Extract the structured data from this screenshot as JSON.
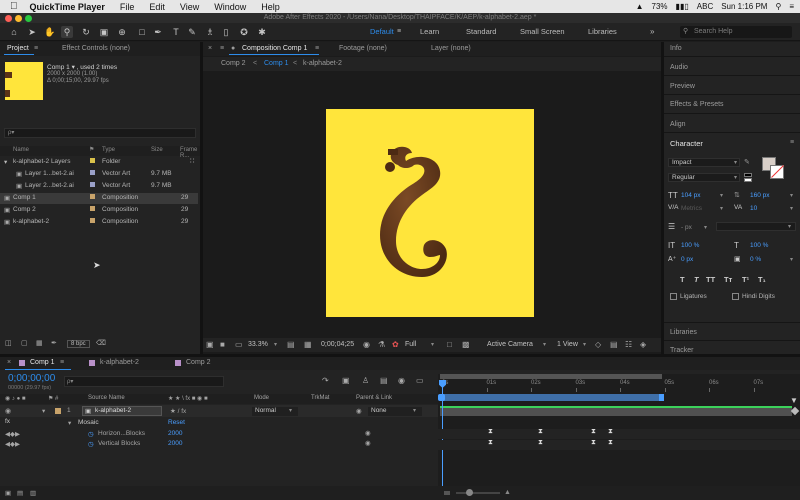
{
  "menubar": {
    "app": "QuickTime Player",
    "items": [
      "File",
      "Edit",
      "View",
      "Window",
      "Help"
    ],
    "battery": "73%",
    "input": "ABC",
    "clock": "Sun 1:16 PM"
  },
  "window_title": "Adobe After Effects 2020 - /Users/Nana/Desktop/THAIPFACE/K/AEP/k-alphabet-2.aep *",
  "workspaces": {
    "items": [
      "Default",
      "Learn",
      "Standard",
      "Small Screen",
      "Libraries"
    ],
    "active": "Default"
  },
  "search_help": {
    "placeholder": "Search Help"
  },
  "project": {
    "tab_project": "Project",
    "tab_effect_controls": "Effect Controls (none)",
    "selected_name": "Comp 1 ▾ , used 2 times",
    "selected_dims": "2000 x 2000 (1.00)",
    "selected_duration": "Δ 0;00;15;00, 29.97 fps",
    "search_placeholder": "ρ▾",
    "columns": {
      "name": "Name",
      "type": "Type",
      "size": "Size",
      "frame_rate": "Frame R..."
    },
    "rows": [
      {
        "name": "k-alphabet-2 Layers",
        "type": "Folder",
        "size": "",
        "fps": "",
        "swatch": "#d9c14a"
      },
      {
        "name": "Layer 1...bet-2.ai",
        "type": "Vector Art",
        "size": "9.7 MB",
        "fps": "",
        "swatch": "#9aa0c8"
      },
      {
        "name": "Layer 2...bet-2.ai",
        "type": "Vector Art",
        "size": "9.7 MB",
        "fps": "",
        "swatch": "#9aa0c8"
      },
      {
        "name": "Comp 1",
        "type": "Composition",
        "size": "",
        "fps": "29",
        "swatch": "#c8a36a"
      },
      {
        "name": "Comp 2",
        "type": "Composition",
        "size": "",
        "fps": "29",
        "swatch": "#c8a36a"
      },
      {
        "name": "k-alphabet-2",
        "type": "Composition",
        "size": "",
        "fps": "29",
        "swatch": "#c8a36a"
      }
    ],
    "bpc": "8 bpc"
  },
  "composition": {
    "tab_comp": "Composition Comp 1",
    "tab_footage": "Footage (none)",
    "tab_layer": "Layer (none)",
    "breadcrumbs": [
      "Comp 2",
      "Comp 1",
      "k-alphabet-2"
    ],
    "zoom": "33.3%",
    "timecode": "0;00;04;25",
    "resolution": "Full",
    "camera": "Active Camera",
    "views": "1 View",
    "frame_color": "#ffe53b",
    "glyph_color": "#5a3317"
  },
  "right_panels": {
    "items": [
      "Info",
      "Audio",
      "Preview",
      "Effects & Presets",
      "Align"
    ],
    "character": "Character",
    "libraries": "Libraries",
    "tracker": "Tracker"
  },
  "character": {
    "font": "Impact",
    "style": "Regular",
    "size": "104 px",
    "leading": "160 px",
    "kerning": "Metrics",
    "tracking": "10",
    "stroke": "- px",
    "v_scale": "100 %",
    "h_scale": "100 %",
    "baseline": "0 px",
    "tsume": "0 %",
    "ligatures": "Ligatures",
    "hindi_digits": "Hindi Digits"
  },
  "timeline": {
    "tabs": [
      "Comp 1",
      "k-alphabet-2",
      "Comp 2"
    ],
    "timecode": "0;00;00;00",
    "fps": "00000 (29.97 fps)",
    "col_source": "Source Name",
    "col_mode": "Mode",
    "col_trkmat": "TrkMat",
    "col_parent": "Parent & Link",
    "layer_num": "1",
    "layer_name": "k-alphabet-2",
    "layer_mode": "Normal",
    "layer_parent": "None",
    "effect": "Mosaic",
    "reset": "Reset",
    "props": [
      {
        "name": "Horizon...Blocks",
        "value": "2000"
      },
      {
        "name": "Vertical Blocks",
        "value": "2000"
      }
    ],
    "ruler": [
      "0s",
      "01s",
      "02s",
      "03s",
      "04s",
      "05s",
      "06s",
      "07s"
    ]
  }
}
